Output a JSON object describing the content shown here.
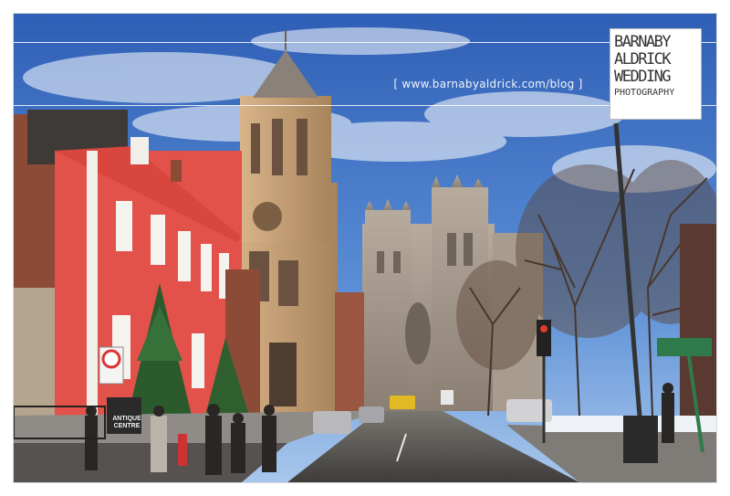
{
  "watermark": {
    "blog_url": "[ www.barnabyaldrick.com/blog ]",
    "logo_lines": [
      "BARNABY",
      "ALDRICK",
      "WEDDING",
      "PHOTOGRAPHY"
    ]
  },
  "scene": {
    "shop_sign": [
      "ANTIQUE",
      "CENTRE"
    ],
    "colors": {
      "sky": "#3f73c6",
      "red_building": "#e2524a",
      "stone": "#c9a67e",
      "road": "#5c5a58"
    }
  }
}
